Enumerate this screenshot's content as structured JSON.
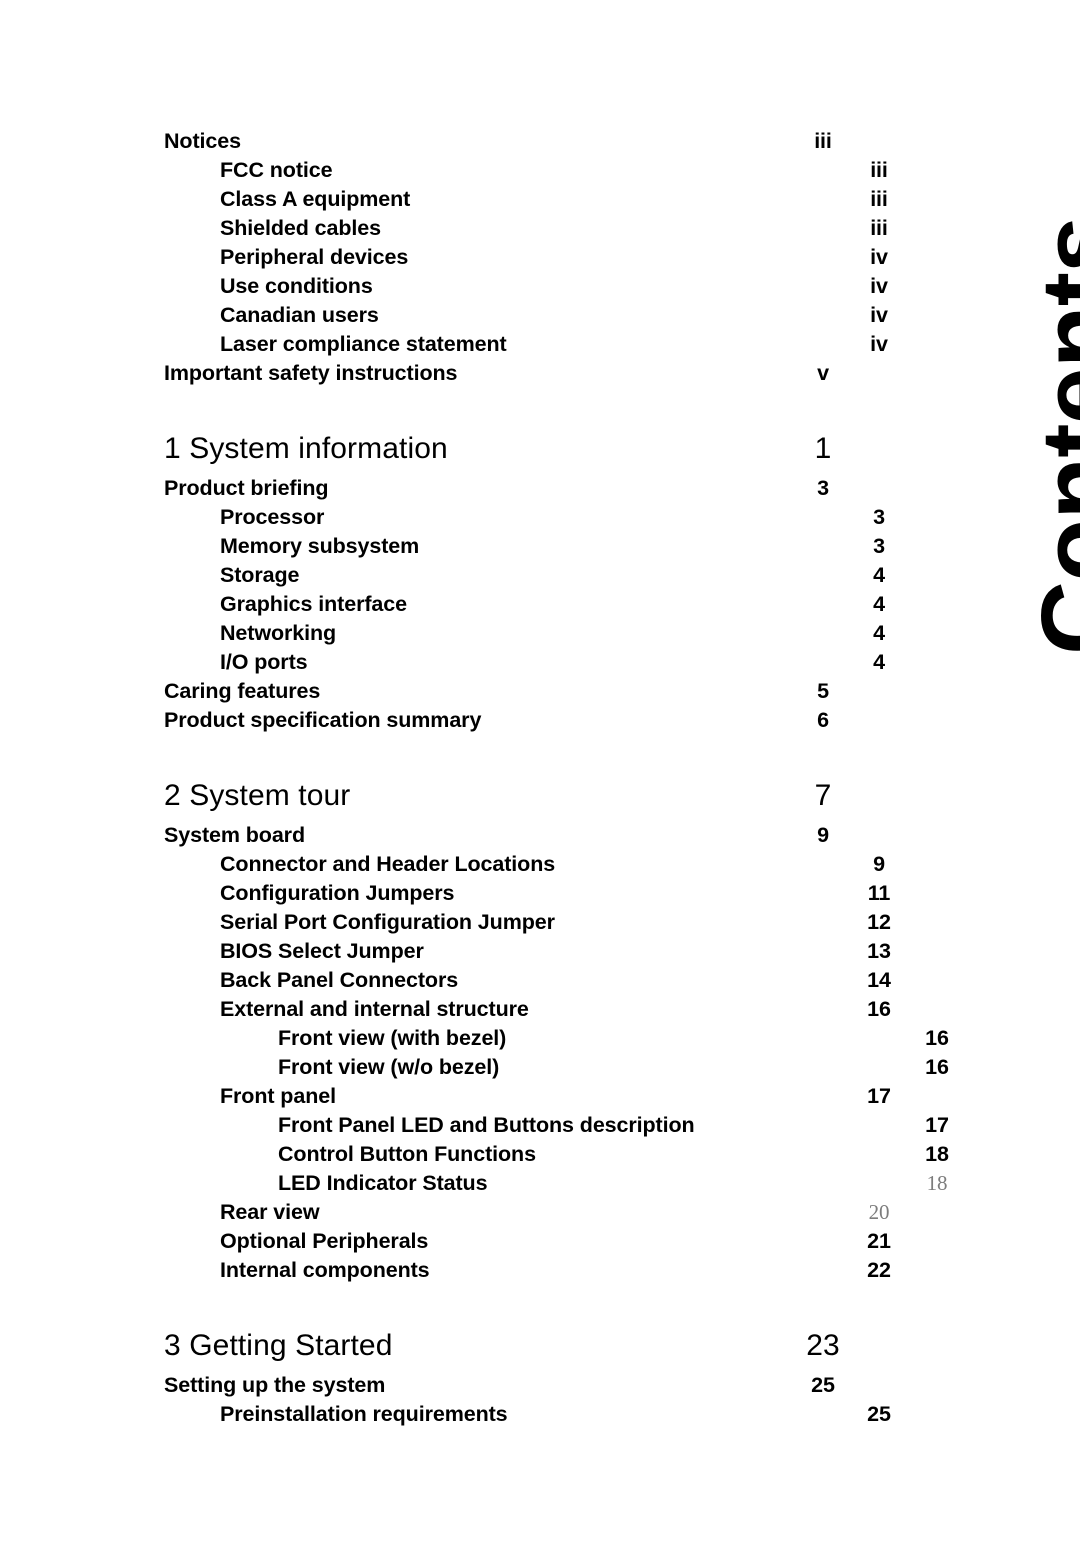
{
  "page": {
    "side_title": "Contents",
    "background_color": "#ffffff",
    "text_color": "#000000",
    "faded_number_color": "#7d7d7d"
  },
  "toc": {
    "entries": [
      {
        "label": "Notices",
        "page": "iii",
        "level": 1,
        "kind": "entry"
      },
      {
        "label": "FCC notice",
        "page": "iii",
        "level": 2,
        "kind": "entry"
      },
      {
        "label": "Class A equipment",
        "page": "iii",
        "level": 2,
        "kind": "entry"
      },
      {
        "label": "Shielded cables",
        "page": "iii",
        "level": 2,
        "kind": "entry"
      },
      {
        "label": "Peripheral devices",
        "page": "iv",
        "level": 2,
        "kind": "entry"
      },
      {
        "label": "Use conditions",
        "page": "iv",
        "level": 2,
        "kind": "entry"
      },
      {
        "label": "Canadian users",
        "page": "iv",
        "level": 2,
        "kind": "entry"
      },
      {
        "label": "Laser compliance statement",
        "page": "iv",
        "level": 2,
        "kind": "entry"
      },
      {
        "label": "Important safety instructions",
        "page": "v",
        "level": 1,
        "kind": "entry"
      },
      {
        "label": "1 System information",
        "page": "1",
        "level": 1,
        "kind": "chapter"
      },
      {
        "label": "Product briefing",
        "page": "3",
        "level": 1,
        "kind": "entry"
      },
      {
        "label": "Processor",
        "page": "3",
        "level": 2,
        "kind": "entry"
      },
      {
        "label": "Memory subsystem",
        "page": "3",
        "level": 2,
        "kind": "entry"
      },
      {
        "label": "Storage",
        "page": "4",
        "level": 2,
        "kind": "entry"
      },
      {
        "label": "Graphics interface",
        "page": "4",
        "level": 2,
        "kind": "entry"
      },
      {
        "label": "Networking",
        "page": "4",
        "level": 2,
        "kind": "entry"
      },
      {
        "label": "I/O ports",
        "page": "4",
        "level": 2,
        "kind": "entry"
      },
      {
        "label": "Caring features",
        "page": "5",
        "level": 1,
        "kind": "entry"
      },
      {
        "label": "Product specification summary",
        "page": "6",
        "level": 1,
        "kind": "entry"
      },
      {
        "label": "2 System tour",
        "page": "7",
        "level": 1,
        "kind": "chapter"
      },
      {
        "label": "System board",
        "page": "9",
        "level": 1,
        "kind": "entry"
      },
      {
        "label": "Connector and Header Locations",
        "page": "9",
        "level": 2,
        "kind": "entry"
      },
      {
        "label": "Configuration Jumpers",
        "page": "11",
        "level": 2,
        "kind": "entry"
      },
      {
        "label": "Serial Port Configuration Jumper",
        "page": "12",
        "level": 2,
        "kind": "entry"
      },
      {
        "label": "BIOS Select Jumper",
        "page": "13",
        "level": 2,
        "kind": "entry"
      },
      {
        "label": "Back Panel Connectors",
        "page": "14",
        "level": 2,
        "kind": "entry"
      },
      {
        "label": "External and internal structure",
        "page": "16",
        "level": 2,
        "kind": "entry"
      },
      {
        "label": "Front view (with bezel)",
        "page": "16",
        "level": 3,
        "kind": "entry"
      },
      {
        "label": "Front view (w/o bezel)",
        "page": "16",
        "level": 3,
        "kind": "entry"
      },
      {
        "label": "Front panel",
        "page": "17",
        "level": 2,
        "kind": "entry"
      },
      {
        "label": "Front Panel LED and Buttons description",
        "page": "17",
        "level": 3,
        "kind": "entry"
      },
      {
        "label": "Control Button Functions",
        "page": "18",
        "level": 3,
        "kind": "entry"
      },
      {
        "label": "LED Indicator Status",
        "page": "18",
        "level": 3,
        "kind": "entry",
        "page_style": "fallback"
      },
      {
        "label": "Rear view",
        "page": "20",
        "level": 2,
        "kind": "entry",
        "page_style": "fallback"
      },
      {
        "label": "Optional Peripherals",
        "page": "21",
        "level": 2,
        "kind": "entry"
      },
      {
        "label": "Internal components",
        "page": "22",
        "level": 2,
        "kind": "entry"
      },
      {
        "label": "3 Getting Started",
        "page": "23",
        "level": 1,
        "kind": "chapter"
      },
      {
        "label": "Setting up the system",
        "page": "25",
        "level": 1,
        "kind": "entry"
      },
      {
        "label": "Preinstallation requirements",
        "page": "25",
        "level": 2,
        "kind": "entry"
      }
    ]
  }
}
